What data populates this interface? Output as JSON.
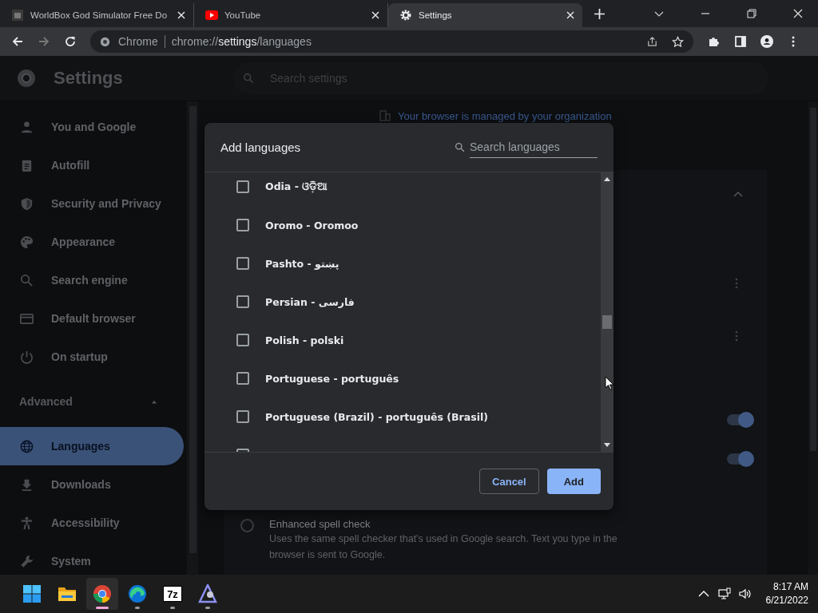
{
  "tabs": [
    {
      "title": "WorldBox God Simulator Free Do",
      "kind": "game",
      "selected": false
    },
    {
      "title": "YouTube",
      "kind": "video",
      "selected": false
    },
    {
      "title": "Settings",
      "kind": "settings",
      "selected": true
    }
  ],
  "address_bar": {
    "site": "Chrome",
    "url": "chrome://**settings**/languages"
  },
  "header": {
    "title": "Settings",
    "search_placeholder": "Search settings"
  },
  "sidebar": {
    "items": [
      {
        "label": "You and Google",
        "selected": false
      },
      {
        "label": "Autofill",
        "selected": false
      },
      {
        "label": "Security and Privacy",
        "selected": false
      },
      {
        "label": "Appearance",
        "selected": false
      },
      {
        "label": "Search engine",
        "selected": false
      },
      {
        "label": "Default browser",
        "selected": false
      },
      {
        "label": "On startup",
        "selected": false
      }
    ],
    "advanced": {
      "label": "Advanced",
      "expanded": true
    },
    "advanced_items": [
      {
        "label": "Languages",
        "selected": true
      },
      {
        "label": "Downloads",
        "selected": false
      },
      {
        "label": "Accessibility",
        "selected": false
      },
      {
        "label": "System",
        "selected": false
      }
    ]
  },
  "main": {
    "managed_notice": "Your browser is managed by your organization",
    "toggles": [
      {
        "on": true
      },
      {
        "on": true
      }
    ],
    "spell_check_option": {
      "label": "Enhanced spell check",
      "description": "Uses the same spell checker that's used in Google search. Text you type in the browser is sent to Google.",
      "selected": false
    }
  },
  "dialog": {
    "title": "Add languages",
    "search_placeholder": "Search languages",
    "languages": [
      {
        "name": "Odia - ଓଡ଼ିଆ",
        "checked": false
      },
      {
        "name": "Oromo - Oromoo",
        "checked": false
      },
      {
        "name": "Pashto - پښتو",
        "checked": false
      },
      {
        "name": "Persian - فارسی",
        "checked": false
      },
      {
        "name": "Polish - polski",
        "checked": false
      },
      {
        "name": "Portuguese - português",
        "checked": false
      },
      {
        "name": "Portuguese (Brazil) - português (Brasil)",
        "checked": false
      }
    ],
    "cancel": "Cancel",
    "add": "Add"
  },
  "taskbar": {
    "apps": [
      {
        "kind": "start",
        "running": false,
        "selected": false
      },
      {
        "kind": "files",
        "running": false,
        "selected": false
      },
      {
        "kind": "chrome",
        "running": true,
        "selected": true
      },
      {
        "kind": "edge",
        "running": true,
        "selected": false
      },
      {
        "kind": "archiver",
        "label": "7z",
        "running": true,
        "selected": false
      },
      {
        "kind": "triangle",
        "running": true,
        "selected": false
      }
    ],
    "time": "8:17 AM",
    "date": "6/21/2022"
  }
}
